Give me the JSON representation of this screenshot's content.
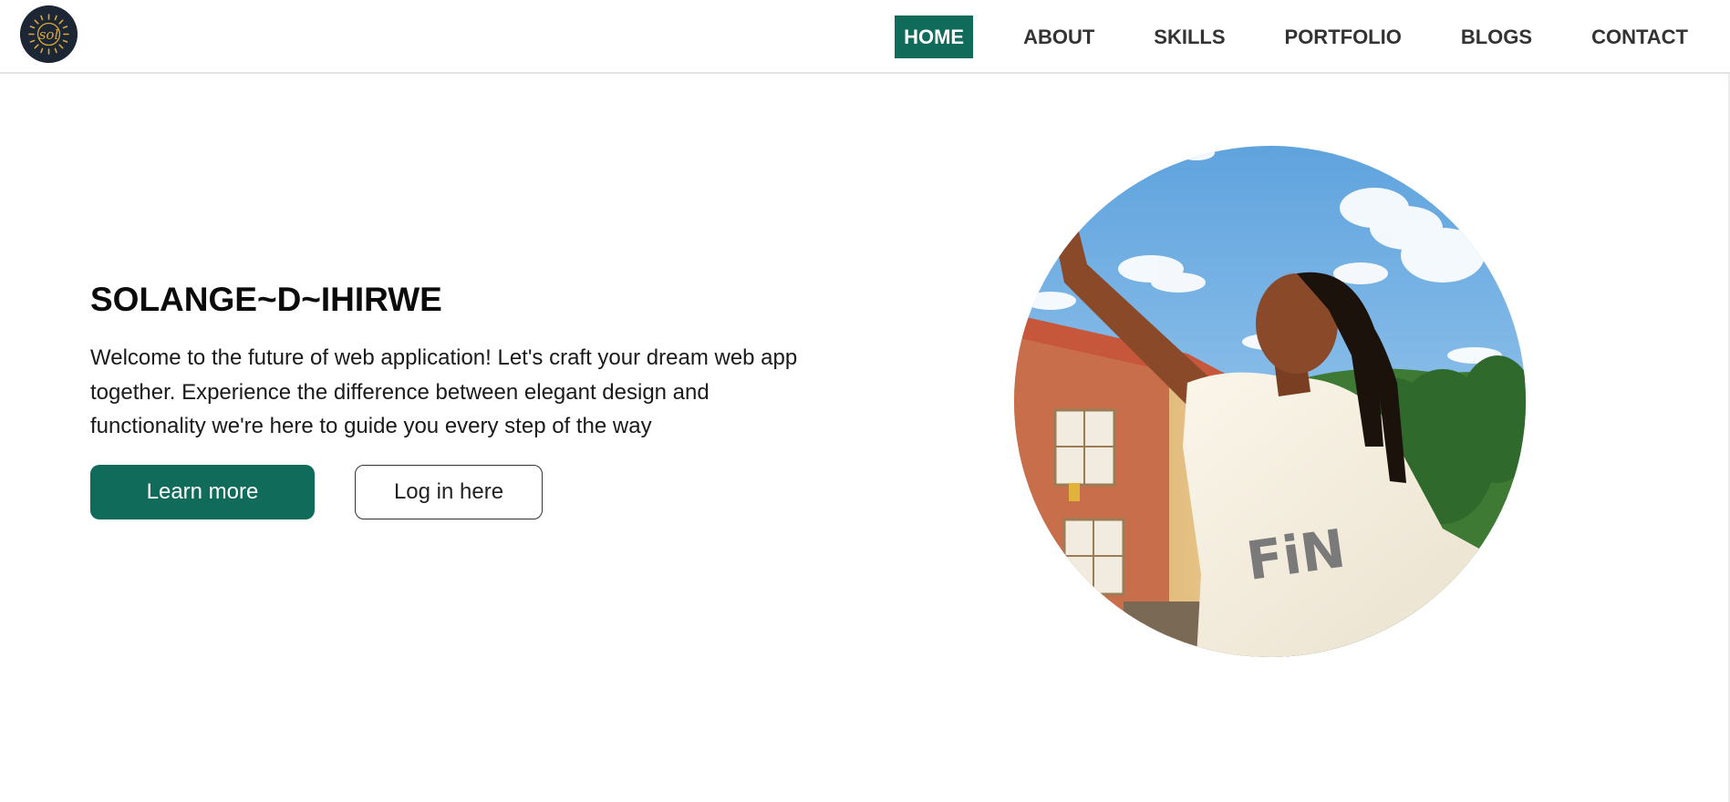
{
  "header": {
    "logo_icon": "sol-sun-logo",
    "logo_text": "sol",
    "nav": [
      {
        "label": "HOME",
        "active": true
      },
      {
        "label": "ABOUT",
        "active": false
      },
      {
        "label": "SKILLS",
        "active": false
      },
      {
        "label": "PORTFOLIO",
        "active": false
      },
      {
        "label": "BLOGS",
        "active": false
      },
      {
        "label": "CONTACT",
        "active": false
      }
    ]
  },
  "hero": {
    "title": "SOLANGE~D~IHIRWE",
    "description": "Welcome to the future of web application! Let's craft your dream web app together. Experience the difference between elegant design and functionality we're here to guide you every step of the way",
    "primary_button": "Learn more",
    "secondary_button": "Log in here"
  },
  "portrait": {
    "icon": "profile-photo"
  },
  "colors": {
    "accent": "#106b5b",
    "logo_bg": "#1c2634",
    "logo_gold": "#d8a83a",
    "text_dark": "#0b0b0b"
  }
}
